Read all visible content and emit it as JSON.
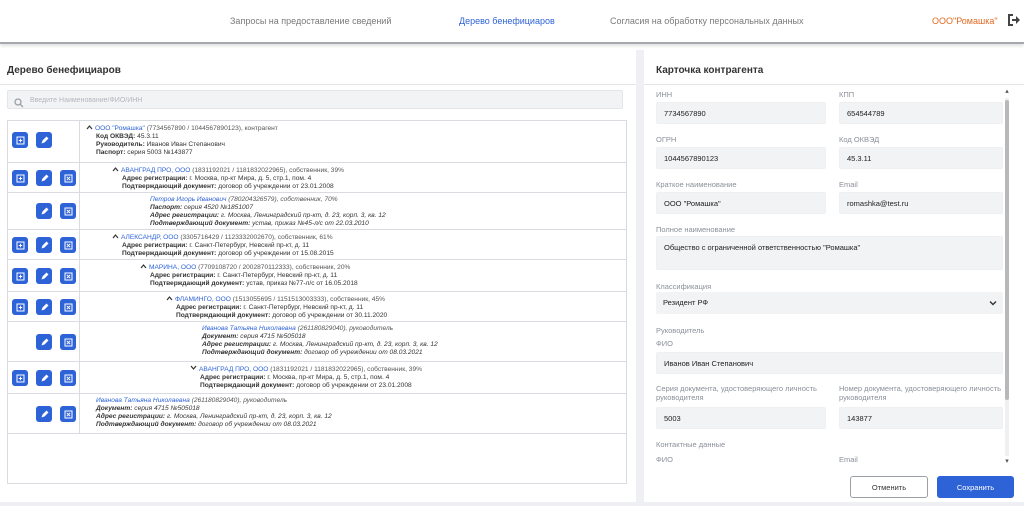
{
  "nav": {
    "tabs": [
      {
        "label": "Запросы на предоставление сведений"
      },
      {
        "label": "Дерево бенефициаров"
      },
      {
        "label": "Согласия на обработку персональных данных"
      }
    ],
    "org": "ООО\"Ромашка\"",
    "logout_icon": "logout-icon"
  },
  "left": {
    "title": "Дерево бенефициаров",
    "search_placeholder": "Введите Наименование/ФИО/ИНН",
    "rows": [
      {
        "name": "ООО \"Ромашка\"",
        "meta": " (7734567890 / 1044567890123), контрагент",
        "l1k": "Код ОКВЭД:",
        "l1v": " 45.3.11",
        "l2k": "Руководитель:",
        "l2v": " Иванов Иван Степанович",
        "l3k": "Паспорт:",
        "l3v": " серия 5003 №143877"
      },
      {
        "name": "АВАНГРАД ПРО, ООО",
        "meta": " (1831192021 / 1181832022965), собственник, 39%",
        "l1k": "Адрес регистрации:",
        "l1v": " г. Москва, пр-кт Мира, д. 5, стр.1, пом. 4",
        "l2k": "Подтверждающий документ:",
        "l2v": " договор об учреждении от 23.01.2008"
      },
      {
        "name": "Петров Игорь Иванович",
        "meta": " (780204326579), собственник, 70%",
        "l1k": "Паспорт:",
        "l1v": " серия 4520 №1851007",
        "l2k": "Адрес регистрации:",
        "l2v": " г. Москва, Ленинградский пр-кт, д. 23, корп. 3, кв. 12",
        "l3k": "Подтверждающий документ:",
        "l3v": " устав, приказ №45-л/с от 22.03.2010"
      },
      {
        "name": "АЛЕКСАНДР, ООО",
        "meta": " (3305716429 / 1123332002670), собственник, 61%",
        "l1k": "Адрес регистрации:",
        "l1v": " г. Санкт-Петербург, Невский пр-кт, д. 11",
        "l2k": "Подтверждающий документ:",
        "l2v": " договор об учреждении от 15.08.2015"
      },
      {
        "name": "МАРИНА, ООО",
        "meta": " (7709108720 / 2002870112333), собственник, 20%",
        "l1k": "Адрес регистрации:",
        "l1v": " г. Санкт-Петербург, Невский пр-кт, д. 11",
        "l2k": "Подтверждающий документ:",
        "l2v": " устав, приказ №77-л/с от 16.05.2018"
      },
      {
        "name": "ФЛАМИНГО, ООО",
        "meta": " (1513055695 / 1151513003333), собственник, 45%",
        "l1k": "Адрес регистрации:",
        "l1v": " г. Санкт-Петербург, Невский пр-кт, д. 11",
        "l2k": "Подтверждающий документ:",
        "l2v": " договор об учреждении от 30.11.2020"
      },
      {
        "name": "Иванова Татьяна Николаевна",
        "meta": " (261180829040), руководитель",
        "l1k": "Документ:",
        "l1v": " серия 4715 №505018",
        "l2k": "Адрес регистрации:",
        "l2v": " г. Москва, Ленинградский пр-кт, д. 23, корп. 3, кв. 12",
        "l3k": "Подтверждающий документ:",
        "l3v": " договор об учреждении от 08.03.2021"
      },
      {
        "name": "АВАНГРАД ПРО, ООО",
        "meta": " (1831192021 / 1181832022965), собственник, 39%",
        "l1k": "Адрес регистрации:",
        "l1v": " г. Москва, пр-кт Мира, д. 5, стр.1, пом. 4",
        "l2k": "Подтверждающий документ:",
        "l2v": " договор об учреждении от 23.01.2008"
      },
      {
        "name": "Иванова Татьяна Николаевна",
        "meta": " (261180829040), руководитель",
        "l1k": "Документ:",
        "l1v": " серия 4715 №505018",
        "l2k": "Адрес регистрации:",
        "l2v": " г. Москва, Ленинградский пр-кт, д. 23, корп. 3, кв. 12",
        "l3k": "Подтверждающий документ:",
        "l3v": " договор об учреждении от 08.03.2021"
      }
    ]
  },
  "card": {
    "title": "Карточка контрагента",
    "inn_label": "ИНН",
    "inn": "7734567890",
    "kpp_label": "КПП",
    "kpp": "654544789",
    "ogrn_label": "ОГРН",
    "ogrn": "1044567890123",
    "okved_label": "Код ОКВЭД",
    "okved": "45.3.11",
    "short_label": "Краткое наименование",
    "short": "ООО \"Ромашка\"",
    "email_label": "Email",
    "email": "romashka@test.ru",
    "full_label": "Полное наименование",
    "full": "Общество с ограниченной ответственностью \"Ромашка\"",
    "class_label": "Классификация",
    "class": "Резидент РФ",
    "head_section": "Руководитель",
    "fio_label": "ФИО",
    "fio": "Иванов Иван Степанович",
    "series_label": "Серия документа, удостоверяющего личность руководителя",
    "series": "5003",
    "number_label": "Номер документа, удостоверяющего личность руководителя",
    "number": "143877",
    "contacts_section": "Контактные данные",
    "c_fio_label": "ФИО",
    "c_email_label": "Email",
    "cancel": "Отменить",
    "save": "Сохранить"
  },
  "colors": {
    "accent": "#2e63d8",
    "org": "#e26a22"
  }
}
